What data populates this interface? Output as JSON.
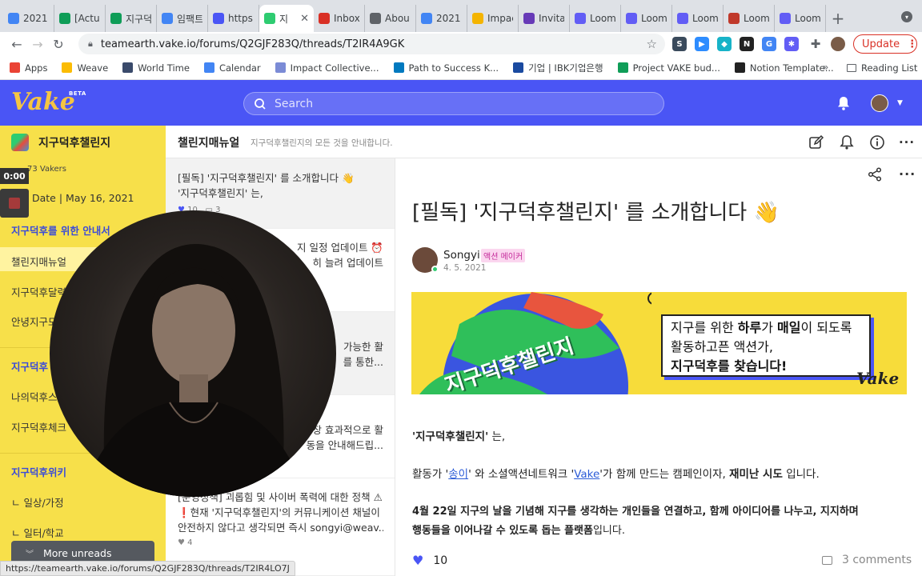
{
  "browser": {
    "tabs": [
      {
        "label": "2021",
        "icon": "docs-icon",
        "color": "#4285f4"
      },
      {
        "label": "[Actu",
        "icon": "sheets-icon",
        "color": "#0f9d58"
      },
      {
        "label": "지구덕",
        "icon": "sheets-icon",
        "color": "#0f9d58"
      },
      {
        "label": "임팩트",
        "icon": "docs-icon",
        "color": "#4285f4"
      },
      {
        "label": "https:",
        "icon": "page-icon",
        "color": "#4a55f5"
      },
      {
        "label": "지",
        "icon": "vake-icon",
        "color": "#2ecc71",
        "active": true
      },
      {
        "label": "Inbox",
        "icon": "gmail-icon",
        "color": "#d93025"
      },
      {
        "label": "Abou",
        "icon": "circle-icon",
        "color": "#5f6368"
      },
      {
        "label": "2021",
        "icon": "docs-icon",
        "color": "#4285f4"
      },
      {
        "label": "Impac",
        "icon": "slides-icon",
        "color": "#f4b400"
      },
      {
        "label": "Invita",
        "icon": "forms-icon",
        "color": "#673ab7"
      },
      {
        "label": "Loom",
        "icon": "loom-icon",
        "color": "#625df5"
      },
      {
        "label": "Loom",
        "icon": "loom-icon",
        "color": "#625df5"
      },
      {
        "label": "Loom",
        "icon": "loom-icon",
        "color": "#625df5"
      },
      {
        "label": "Loom",
        "icon": "page-icon",
        "color": "#c0392b"
      },
      {
        "label": "Loom",
        "icon": "loom-icon",
        "color": "#625df5"
      }
    ],
    "url": "teamearth.vake.io/forums/Q2GJF283Q/threads/T2IR4A9GK",
    "update_label": "Update",
    "bookmarks": [
      {
        "label": "Apps",
        "icon": "apps-icon",
        "color": "#ea4335"
      },
      {
        "label": "Weave",
        "icon": "drive-icon",
        "color": "#fbbc04"
      },
      {
        "label": "World Time",
        "icon": "bookmark-icon",
        "color": "#3a4a6b"
      },
      {
        "label": "Calendar",
        "icon": "calendar-icon",
        "color": "#4285f4"
      },
      {
        "label": "Impact Collective...",
        "icon": "bookmark-icon",
        "color": "#7b8bd6"
      },
      {
        "label": "Path to Success K...",
        "icon": "trello-icon",
        "color": "#0079bf"
      },
      {
        "label": "기업 | IBK기업은행",
        "icon": "ibk-icon",
        "color": "#1a4aa0"
      },
      {
        "label": "Project VAKE bud...",
        "icon": "sheets-icon",
        "color": "#0f9d58"
      },
      {
        "label": "Notion Template...",
        "icon": "notion-icon",
        "color": "#222222"
      }
    ],
    "bookmarks_more": "»",
    "reading_list": "Reading List",
    "status_url": "https://teamearth.vake.io/forums/Q2GJF283Q/threads/T2IR4LO7J"
  },
  "app": {
    "logo": "Vake",
    "beta": "BETA",
    "search_placeholder": "Search",
    "accent": "#4a55f5"
  },
  "sidebar": {
    "title": "지구덕후챌린지",
    "members": "73 Vakers",
    "date": "Date | May 16, 2021",
    "section1": "지구덕후를 위한 안내서",
    "items1": [
      "챌린지매뉴얼",
      "지구덕후달력",
      "안녕지구모"
    ],
    "section2": "지구덕후",
    "items2": [
      "나의덕후스",
      "지구덕후체크"
    ],
    "section3": "지구덕후위키",
    "items3": [
      "ㄴ 일상/가정",
      "ㄴ 일터/학교"
    ],
    "more_unreads": "More unreads",
    "timer": "0:00"
  },
  "channel": {
    "title": "챌린지매뉴얼",
    "description": "지구덕후챌린지의 모든 것을 안내합니다."
  },
  "threads": [
    {
      "line1": "[필독] '지구덕후챌린지' 를 소개합니다 👋",
      "line2": "'지구덕후챌린지' 는,",
      "likes": "10",
      "comments": "3"
    },
    {
      "line1": "지 일정 업데이트 ⏰",
      "line2": "히 늘려 업데이트",
      "likes": "",
      "comments": ""
    },
    {
      "line1": "가능한 활",
      "line2": "를 통한...",
      "likes": "",
      "comments": ""
    },
    {
      "line1": "장 효과적으로 활",
      "line2": "동을 안내해드립...",
      "likes": "",
      "comments": ""
    },
    {
      "line1": "[운영정책] 괴롭힘 및 사이버 폭력에 대한 정책 ⚠",
      "line2": "❗현재 '지구덕후챌린지'의 커뮤니케이션 채널이",
      "line3": "안전하지 않다고 생각되면 즉시 songyi@weav...",
      "likes": "4",
      "comments": ""
    }
  ],
  "post": {
    "title": "[필독] '지구덕후챌린지' 를 소개합니다 👋",
    "author": "Songyi",
    "badge": "액션 메이커",
    "date": "4. 5. 2021",
    "banner": {
      "globe_text": "지구덕후챌린지",
      "line1_a": "지구를 위한 ",
      "line1_b": "하루",
      "line1_c": "가 ",
      "line1_d": "매일",
      "line1_e": "이 되도록",
      "line2": "활동하고픈 액션가,",
      "line3": "지구덕후를 찾습니다!",
      "brand": "Vake"
    },
    "p1_bold": "'지구덕후챌린지'",
    "p1_rest": " 는,",
    "p2_a": "활동가 '",
    "p2_link1": "송이",
    "p2_b": "' 와 소셜액션네트워크 '",
    "p2_link2": "Vake",
    "p2_c": "'가 함께 만드는 캠페인이자, ",
    "p2_bold": "재미난 시도",
    "p2_d": " 입니다.",
    "p3_line1": "4월 22일 지구의 날을 기념해 지구를 생각하는 개인들을 연결하고, 함께 아이디어를 나누고, 지지하며",
    "p3_line2_bold": "행동들을 이어나갈 수 있도록 돕는 플랫폼",
    "p3_line2_rest": "입니다.",
    "likes": "10",
    "comments": "3 comments"
  }
}
